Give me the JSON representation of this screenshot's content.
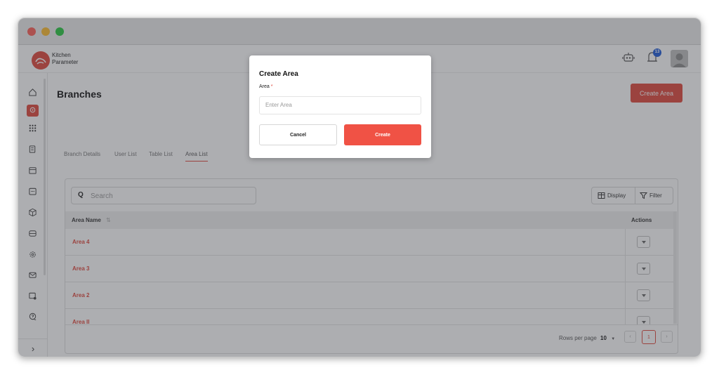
{
  "window": {
    "dots": [
      "#fe5f57",
      "#febc2e",
      "#28c840"
    ]
  },
  "brand": {
    "line1": "Kitchen",
    "line2": "Parameter"
  },
  "header": {
    "notification_count": "13"
  },
  "page": {
    "title": "Branches",
    "create_button": "Create Area"
  },
  "tabs": [
    "Branch Details",
    "User List",
    "Table List",
    "Area List"
  ],
  "active_tab": "Area List",
  "toolbar": {
    "search_icon": "Q",
    "search_placeholder": "Search",
    "display_label": "Display",
    "filter_label": "Filter"
  },
  "table": {
    "columns": [
      "Area Name",
      "Actions"
    ],
    "sort_icon": "⇅",
    "rows": [
      {
        "name": "Area 4"
      },
      {
        "name": "Area 3"
      },
      {
        "name": "Area 2"
      },
      {
        "name": "Area II"
      }
    ]
  },
  "pagination": {
    "rows_per_page_label": "Rows per page",
    "rows_per_page_value": "10",
    "current_page": "1",
    "prev": "‹",
    "next": "›"
  },
  "modal": {
    "title": "Create Area",
    "field_label": "Area",
    "required_mark": "*",
    "placeholder": "Enter Area",
    "cancel_label": "Cancel",
    "create_label": "Create"
  },
  "sidebar": {
    "toggle": "›"
  },
  "colors": {
    "accent": "#e0473c",
    "create_button": "#f05245",
    "notification_badge": "#1e5bd8"
  }
}
